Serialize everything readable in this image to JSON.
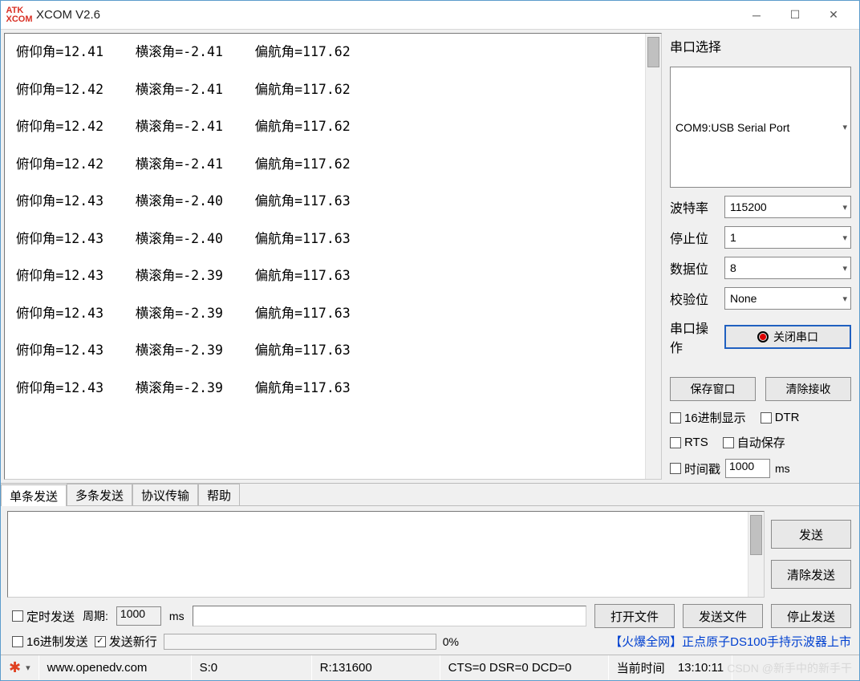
{
  "title": "XCOM V2.6",
  "receiver_lines": [
    "俯仰角=12.41    横滚角=-2.41    偏航角=117.62",
    "",
    "俯仰角=12.42    横滚角=-2.41    偏航角=117.62",
    "",
    "俯仰角=12.42    横滚角=-2.41    偏航角=117.62",
    "",
    "俯仰角=12.42    横滚角=-2.41    偏航角=117.62",
    "",
    "俯仰角=12.43    横滚角=-2.40    偏航角=117.63",
    "",
    "俯仰角=12.43    横滚角=-2.40    偏航角=117.63",
    "",
    "俯仰角=12.43    横滚角=-2.39    偏航角=117.63",
    "",
    "俯仰角=12.43    横滚角=-2.39    偏航角=117.63",
    "",
    "俯仰角=12.43    横滚角=-2.39    偏航角=117.63",
    "",
    "俯仰角=12.43    横滚角=-2.39    偏航角=117.63"
  ],
  "side": {
    "port_section": "串口选择",
    "port_value": "COM9:USB Serial Port",
    "baud_label": "波特率",
    "baud_value": "115200",
    "stop_label": "停止位",
    "stop_value": "1",
    "data_label": "数据位",
    "data_value": "8",
    "parity_label": "校验位",
    "parity_value": "None",
    "op_label": "串口操作",
    "op_btn": "关闭串口",
    "save_btn": "保存窗口",
    "clear_rx_btn": "清除接收",
    "hex_disp": "16进制显示",
    "dtr": "DTR",
    "rts": "RTS",
    "autosave": "自动保存",
    "timestamp": "时间戳",
    "ts_value": "1000",
    "ts_unit": "ms"
  },
  "tabs": {
    "t1": "单条发送",
    "t2": "多条发送",
    "t3": "协议传输",
    "t4": "帮助"
  },
  "send": {
    "send_btn": "发送",
    "clear_btn": "清除发送"
  },
  "opts": {
    "timed": "定时发送",
    "period_lab": "周期:",
    "period_val": "1000",
    "period_unit": "ms",
    "open_file": "打开文件",
    "send_file": "发送文件",
    "stop_send": "停止发送",
    "hex_send": "16进制发送",
    "send_nl": "发送新行",
    "pct": "0%",
    "promo": "【火爆全网】正点原子DS100手持示波器上市"
  },
  "status": {
    "url": "www.openedv.com",
    "s": "S:0",
    "r": "R:131600",
    "cts": "CTS=0 DSR=0 DCD=0",
    "time_lab": "当前时间",
    "time_val": "13:10:11"
  },
  "watermark": "CSDN @新手中的新手干"
}
